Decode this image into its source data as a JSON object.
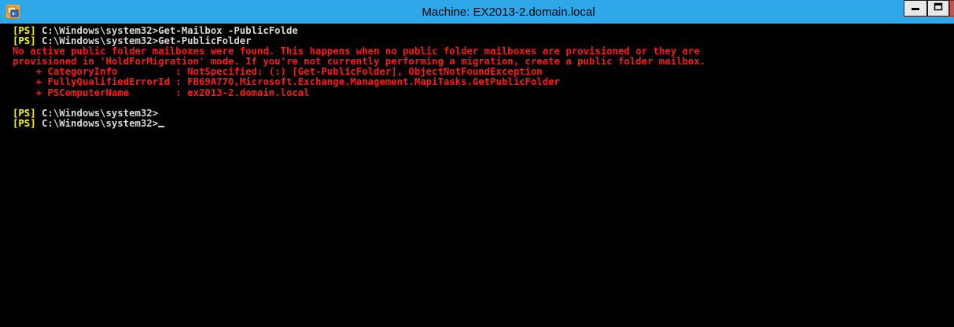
{
  "window": {
    "title": "Machine: EX2013-2.domain.local",
    "controls": {
      "minimize": "minimize",
      "maximize": "maximize",
      "close": "close"
    }
  },
  "console": {
    "lines": [
      {
        "prompt": "[PS]",
        "text": " C:\\Windows\\system32>Get-Mailbox -PublicFolde",
        "style": "cmd"
      },
      {
        "prompt": "[PS]",
        "text": " C:\\Windows\\system32>Get-PublicFolder",
        "style": "cmd"
      },
      {
        "prompt": "",
        "text": "No active public folder mailboxes were found. This happens when no public folder mailboxes are provisioned or they are",
        "style": "err"
      },
      {
        "prompt": "",
        "text": "provisioned in 'HoldForMigration' mode. If you're not currently performing a migration, create a public folder mailbox.",
        "style": "err"
      },
      {
        "prompt": "",
        "text": "    + CategoryInfo          : NotSpecified: (:) [Get-PublicFolder], ObjectNotFoundException",
        "style": "err"
      },
      {
        "prompt": "",
        "text": "    + FullyQualifiedErrorId : FB69A770,Microsoft.Exchange.Management.MapiTasks.GetPublicFolder",
        "style": "err"
      },
      {
        "prompt": "",
        "text": "    + PSComputerName        : ex2013-2.domain.local",
        "style": "err"
      },
      {
        "prompt": "",
        "text": "",
        "style": "blank"
      },
      {
        "prompt": "[PS]",
        "text": " C:\\Windows\\system32>",
        "style": "cmd"
      },
      {
        "prompt": "[PS]",
        "text": " C:\\Windows\\system32>",
        "style": "cmd",
        "cursor": true
      }
    ]
  },
  "colors": {
    "titlebar": "#2ea8e8",
    "console_bg": "#000000",
    "prompt": "#ffff00",
    "text": "#d9d9d9",
    "error": "#ff1a1a"
  },
  "icons": [
    "powershell-app-icon",
    "minimize-icon",
    "maximize-icon",
    "close-icon"
  ]
}
